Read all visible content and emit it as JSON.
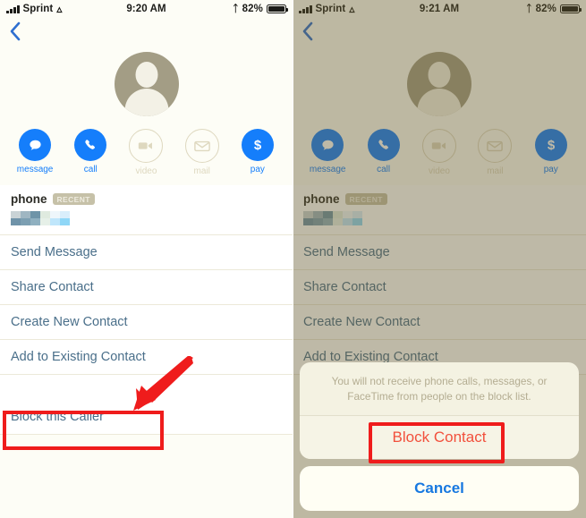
{
  "left_panel": {
    "status_bar": {
      "carrier": "Sprint",
      "time": "9:20 AM",
      "battery_percent": "82%",
      "wifi_icon": "wifi-icon",
      "bluetooth_icon": "bluetooth-icon",
      "signal_icon": "signal-bars-icon",
      "battery_icon": "battery-icon"
    },
    "back_button_icon": "chevron-left-icon",
    "avatar_icon": "contact-avatar-placeholder-icon",
    "quick_actions": [
      {
        "label": "message",
        "icon": "message-bubble-icon",
        "enabled": true
      },
      {
        "label": "call",
        "icon": "phone-handset-icon",
        "enabled": true
      },
      {
        "label": "video",
        "icon": "video-camera-icon",
        "enabled": false
      },
      {
        "label": "mail",
        "icon": "envelope-icon",
        "enabled": false
      },
      {
        "label": "pay",
        "icon": "dollar-sign-icon",
        "enabled": true
      }
    ],
    "phone_field": {
      "label": "phone",
      "badge": "RECENT",
      "value_redacted": true
    },
    "menu_items": [
      "Send Message",
      "Share Contact",
      "Create New Contact",
      "Add to Existing Contact"
    ],
    "block_item": "Block this Caller",
    "annotation": {
      "arrow_icon": "red-arrow-pointing-down-left",
      "highlight_color": "#ef1c1c"
    }
  },
  "right_panel": {
    "status_bar": {
      "carrier": "Sprint",
      "time": "9:21 AM",
      "battery_percent": "82%",
      "wifi_icon": "wifi-icon",
      "bluetooth_icon": "bluetooth-icon",
      "signal_icon": "signal-bars-icon",
      "battery_icon": "battery-icon"
    },
    "back_button_icon": "chevron-left-icon",
    "avatar_icon": "contact-avatar-placeholder-icon",
    "quick_actions": [
      {
        "label": "message",
        "icon": "message-bubble-icon",
        "enabled": true
      },
      {
        "label": "call",
        "icon": "phone-handset-icon",
        "enabled": true
      },
      {
        "label": "video",
        "icon": "video-camera-icon",
        "enabled": false
      },
      {
        "label": "mail",
        "icon": "envelope-icon",
        "enabled": false
      },
      {
        "label": "pay",
        "icon": "dollar-sign-icon",
        "enabled": true
      }
    ],
    "phone_field": {
      "label": "phone",
      "badge": "RECENT",
      "value_redacted": true
    },
    "menu_items": [
      "Send Message",
      "Share Contact",
      "Create New Contact",
      "Add to Existing Contact"
    ],
    "action_sheet": {
      "message": "You will not receive phone calls, messages, or FaceTime from people on the block list.",
      "destructive_button": "Block Contact",
      "cancel_button": "Cancel"
    },
    "annotation": {
      "highlight_color": "#ef1c1c"
    }
  },
  "colors": {
    "accent_blue": "#157efb",
    "link_blue": "#4a6f8a",
    "destructive_red": "#f2503c",
    "cancel_blue": "#1778e0",
    "highlight_red": "#ef1c1c",
    "avatar_gray": "#a39d85",
    "dim_overlay": "rgba(101,88,45,0.42)"
  }
}
